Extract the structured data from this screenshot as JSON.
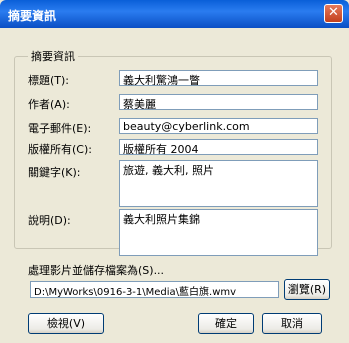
{
  "window": {
    "title": "摘要資訊",
    "close_glyph": "✕"
  },
  "group": {
    "legend": "摘要資訊"
  },
  "fields": {
    "title_label": "標題(T):",
    "title_value": "義大利驚鴻一瞥",
    "author_label": "作者(A):",
    "author_value": "蔡美麗",
    "email_label": "電子郵件(E):",
    "email_value": "beauty@cyberlink.com",
    "copyright_label": "版權所有(C):",
    "copyright_value": "版權所有 2004",
    "keywords_label": "關鍵字(K):",
    "keywords_value": "旅遊, 義大利, 照片",
    "description_label": "說明(D):",
    "description_value": "義大利照片集錦"
  },
  "save": {
    "label": "處理影片並儲存檔案為(S)...",
    "path": "D:\\MyWorks\\0916-3-1\\Media\\藍白旗.wmv",
    "browse_label": "瀏覽(R)"
  },
  "buttons": {
    "preview": "檢視(V)",
    "ok": "確定",
    "cancel": "取消"
  }
}
